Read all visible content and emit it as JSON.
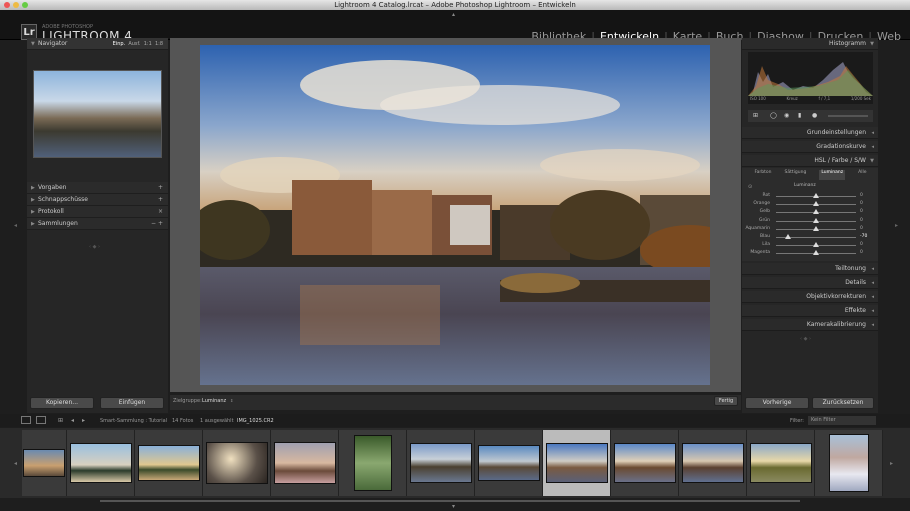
{
  "window": {
    "title": "Lightroom 4 Catalog.lrcat – Adobe Photoshop Lightroom – Entwickeln"
  },
  "brand": {
    "logo": "Lr",
    "subtitle": "ADOBE PHOTOSHOP",
    "name": "LIGHTROOM 4"
  },
  "modules": [
    {
      "label": "Bibliothek",
      "active": false
    },
    {
      "label": "Entwickeln",
      "active": true
    },
    {
      "label": "Karte",
      "active": false
    },
    {
      "label": "Buch",
      "active": false
    },
    {
      "label": "Diashow",
      "active": false
    },
    {
      "label": "Drucken",
      "active": false
    },
    {
      "label": "Web",
      "active": false
    }
  ],
  "left": {
    "navigator": {
      "title": "Navigator",
      "zooms": [
        "Einp.",
        "Ausf.",
        "1:1",
        "1:8"
      ]
    },
    "sections": [
      {
        "label": "Vorgaben",
        "action": "+"
      },
      {
        "label": "Schnappschüsse",
        "action": "+"
      },
      {
        "label": "Protokoll",
        "action": "×"
      },
      {
        "label": "Sammlungen",
        "action": "− +"
      }
    ],
    "copy_button": "Kopieren...",
    "paste_button": "Einfügen"
  },
  "center": {
    "target_label": "Zielgruppe:",
    "target_value": "Luminanz",
    "done_button": "Fertig"
  },
  "right": {
    "histogram": {
      "title": "Histogramm",
      "meta": [
        "ISO 100",
        "Kreuz",
        "f / 7,1",
        "1/200 Sek"
      ]
    },
    "sections_top": [
      {
        "label": "Grundeinstellungen"
      },
      {
        "label": "Gradationskurve"
      }
    ],
    "hsl": {
      "title": "HSL / Farbe / S/W",
      "tabs": [
        "Farbton",
        "Sättigung",
        "Luminanz",
        "Alle"
      ],
      "active_tab": "Luminanz",
      "group_label": "Luminanz",
      "rows": [
        {
          "label": "Rot",
          "value": 0
        },
        {
          "label": "Orange",
          "value": 0
        },
        {
          "label": "Gelb",
          "value": 0
        },
        {
          "label": "Grün",
          "value": 0
        },
        {
          "label": "Aquamarin",
          "value": 0
        },
        {
          "label": "Blau",
          "value": -70
        },
        {
          "label": "Lila",
          "value": 0
        },
        {
          "label": "Magenta",
          "value": 0
        }
      ]
    },
    "sections_bottom": [
      {
        "label": "Teiltonung"
      },
      {
        "label": "Details"
      },
      {
        "label": "Objektivkorrekturen"
      },
      {
        "label": "Effekte"
      },
      {
        "label": "Kamerakalibrierung"
      }
    ],
    "prev_button": "Vorherige",
    "reset_button": "Zurücksetzen"
  },
  "filmstrip": {
    "info_source": "Smart-Sammlung : Tutorial",
    "info_count": "14 Fotos",
    "info_selected": "1 ausgewählt",
    "info_file": "IMG_1025.CR2",
    "filter_label": "Filter:",
    "filter_value": "Kein Filter"
  }
}
